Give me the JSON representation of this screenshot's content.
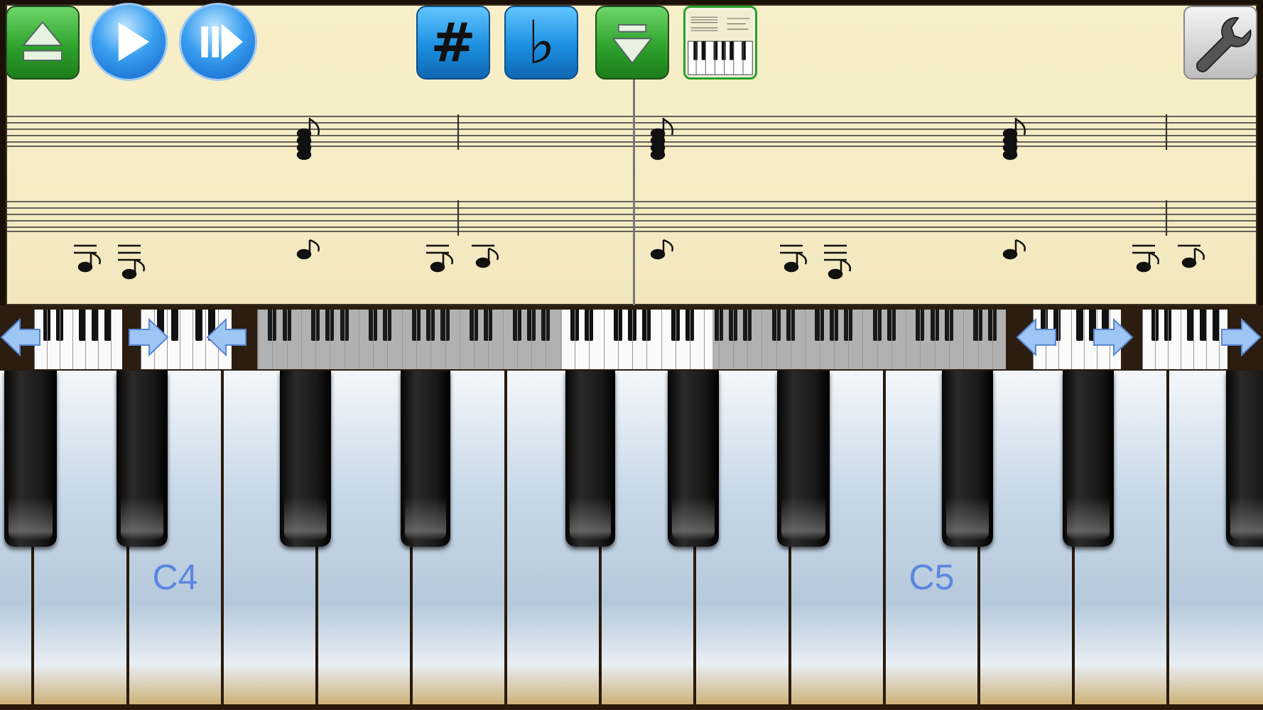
{
  "toolbar": {
    "eject_icon": "eject-icon",
    "play_icon": "play-icon",
    "step_icon": "step-play-icon",
    "sharp_label": "#",
    "flat_label": "♭",
    "down_icon": "chevron-down-icon",
    "thumbnail_icon": "song-thumbnail-icon",
    "settings_icon": "wrench-icon"
  },
  "keyboard": {
    "labels": {
      "c4": "C4",
      "c5": "C5"
    }
  },
  "colors": {
    "sheet_bg": "#f7efc8",
    "green_button": "#2ea32c",
    "blue_button": "#1c8fe0",
    "key_label": "#5a86e0"
  }
}
